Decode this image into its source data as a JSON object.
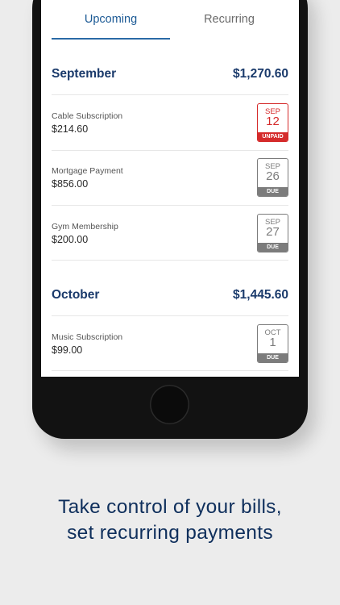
{
  "tabs": [
    {
      "label": "Upcoming",
      "active": true
    },
    {
      "label": "Recurring",
      "active": false
    }
  ],
  "months": [
    {
      "name": "September",
      "total": "$1,270.60",
      "bills": [
        {
          "name": "Cable Subscription",
          "amount": "$214.60",
          "cal_month": "SEP",
          "cal_day": "12",
          "status": "UNPAID"
        },
        {
          "name": "Mortgage Payment",
          "amount": "$856.00",
          "cal_month": "SEP",
          "cal_day": "26",
          "status": "DUE"
        },
        {
          "name": "Gym Membership",
          "amount": "$200.00",
          "cal_month": "SEP",
          "cal_day": "27",
          "status": "DUE"
        }
      ]
    },
    {
      "name": "October",
      "total": "$1,445.60",
      "bills": [
        {
          "name": "Music Subscription",
          "amount": "$99.00",
          "cal_month": "OCT",
          "cal_day": "1",
          "status": "DUE"
        }
      ]
    }
  ],
  "caption": {
    "line1": "Take control of your bills,",
    "line2": "set recurring payments"
  },
  "colors": {
    "accent": "#1c5a95",
    "heading": "#1a3a6b",
    "unpaid": "#d52b2b",
    "due": "#7c7c7c",
    "background": "#ececec"
  }
}
